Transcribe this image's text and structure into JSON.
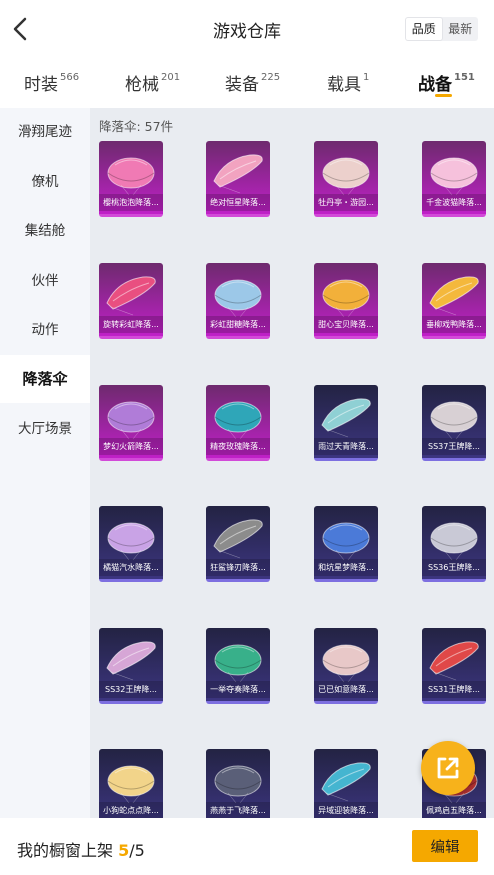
{
  "header": {
    "title": "游戏仓库",
    "sort": [
      "品质",
      "最新"
    ]
  },
  "tabs": [
    {
      "label": "时装",
      "count": "566"
    },
    {
      "label": "枪械",
      "count": "201"
    },
    {
      "label": "装备",
      "count": "225"
    },
    {
      "label": "载具",
      "count": "1"
    },
    {
      "label": "战备",
      "count": "151"
    }
  ],
  "sidebar": [
    "滑翔尾迹",
    "僚机",
    "集结舱",
    "伙伴",
    "动作",
    "降落伞",
    "大厅场景"
  ],
  "content": {
    "count_label": "降落伞: 57件",
    "items": [
      {
        "name": "樱桃泡泡降落...",
        "quality": "pink",
        "icon": "parachute-icon",
        "color": "#f07ab4"
      },
      {
        "name": "绝对恒星降落...",
        "quality": "pink",
        "icon": "parachute-icon",
        "color": "#f2a3c0"
      },
      {
        "name": "牡丹亭・游园...",
        "quality": "pink",
        "icon": "parachute-icon",
        "color": "#ecd0cc"
      },
      {
        "name": "千金波猫降落...",
        "quality": "pink",
        "icon": "parachute-icon",
        "color": "#f6c1dc"
      },
      {
        "name": "旋转彩虹降落...",
        "quality": "pink",
        "icon": "parachute-icon",
        "color": "#e94f80"
      },
      {
        "name": "彩虹甜糖降落...",
        "quality": "pink",
        "icon": "parachute-icon",
        "color": "#9cc8e8"
      },
      {
        "name": "甜心宝贝降落...",
        "quality": "pink",
        "icon": "parachute-icon",
        "color": "#f2b03a"
      },
      {
        "name": "垂柳戏鸭降落...",
        "quality": "pink",
        "icon": "parachute-icon",
        "color": "#f4b83c"
      },
      {
        "name": "梦幻火箭降落...",
        "quality": "pink",
        "icon": "parachute-icon",
        "color": "#b07cd8"
      },
      {
        "name": "精夜玫瑰降落...",
        "quality": "pink",
        "icon": "parachute-icon",
        "color": "#2fa6b8"
      },
      {
        "name": "雨过天青降落...",
        "quality": "blue",
        "icon": "parachute-icon",
        "color": "#8fd0d4"
      },
      {
        "name": "SS37王牌降...",
        "quality": "blue",
        "icon": "parachute-icon",
        "color": "#d8d0d4"
      },
      {
        "name": "橘猫汽水降落...",
        "quality": "blue",
        "icon": "parachute-icon",
        "color": "#c9a3e6"
      },
      {
        "name": "狂鲨锋刃降落...",
        "quality": "blue",
        "icon": "parachute-icon",
        "color": "#8c8c8c"
      },
      {
        "name": "和坑星梦降落...",
        "quality": "blue",
        "icon": "parachute-icon",
        "color": "#4b7ad8"
      },
      {
        "name": "SS36王牌降...",
        "quality": "blue",
        "icon": "parachute-icon",
        "color": "#c9c9d6"
      },
      {
        "name": "SS32王牌降...",
        "quality": "blue",
        "icon": "parachute-icon",
        "color": "#d6a6d6"
      },
      {
        "name": "一举夺奏降落...",
        "quality": "blue",
        "icon": "parachute-icon",
        "color": "#38b08a"
      },
      {
        "name": "已已如意降落...",
        "quality": "blue",
        "icon": "parachute-icon",
        "color": "#e8c8c8"
      },
      {
        "name": "SS31王牌降...",
        "quality": "blue",
        "icon": "parachute-icon",
        "color": "#e04848"
      },
      {
        "name": "小狗蛇点点降...",
        "quality": "blue",
        "icon": "parachute-icon",
        "color": "#f2d48a"
      },
      {
        "name": "燕燕于飞降落...",
        "quality": "blue",
        "icon": "parachute-icon",
        "color": "#5a5f78"
      },
      {
        "name": "异域迎装降落...",
        "quality": "blue",
        "icon": "parachute-icon",
        "color": "#45b5d0"
      },
      {
        "name": "佩鸡启五降落...",
        "quality": "blue",
        "icon": "parachute-icon",
        "color": "#b03030"
      }
    ]
  },
  "bottom": {
    "shelf_label": "我的橱窗上架",
    "shelf_current": "5",
    "shelf_total": "/5",
    "edit_label": "编辑"
  },
  "colors": {
    "accent": "#f5a800"
  }
}
